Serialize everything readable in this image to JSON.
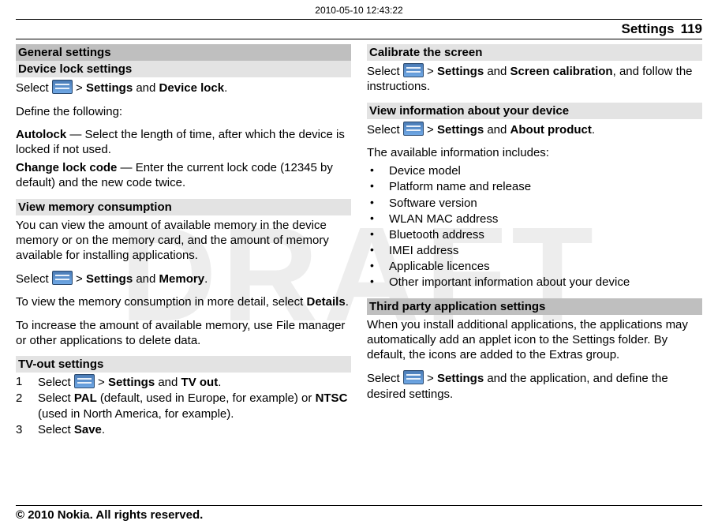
{
  "meta": {
    "timestamp": "2010-05-10 12:43:22",
    "watermark": "DRAFT"
  },
  "header": {
    "section": "Settings",
    "page_no": "119"
  },
  "footer": {
    "copyright": "© 2010 Nokia. All rights reserved."
  },
  "common": {
    "gt": ">",
    "and": "and",
    "settings_link": "Settings",
    "select": "Select"
  },
  "left": {
    "general_heading": "General settings",
    "device_lock": {
      "heading": "Device lock settings",
      "nav_target": "Device lock",
      "nav_suffix": ".",
      "define_intro": "Define the following:",
      "autolock_label": "Autolock",
      "autolock_desc": " — Select the length of time, after which the device is locked if not used.",
      "change_code_label": "Change lock code",
      "change_code_desc": " — Enter the current lock code (12345 by default) and the new code twice."
    },
    "memory": {
      "heading": "View memory consumption",
      "intro": "You can view the amount of available memory in the device memory or on the memory card, and the amount of memory available for installing applications.",
      "nav_target": "Memory",
      "nav_suffix": ".",
      "details_pre": "To view the memory consumption in more detail, select ",
      "details_link": "Details",
      "details_post": ".",
      "increase": "To increase the amount of available memory, use File manager or other applications to delete data."
    },
    "tvout": {
      "heading": "TV-out settings",
      "step1_target": "TV out",
      "step1_suffix": ".",
      "step2_pre": "Select ",
      "step2_pal": "PAL",
      "step2_mid": " (default, used in Europe, for example) or ",
      "step2_ntsc": "NTSC",
      "step2_post": " (used in North America, for example).",
      "step3_pre": "Select ",
      "step3_save": "Save",
      "step3_post": "."
    }
  },
  "right": {
    "calibrate": {
      "heading": "Calibrate the screen",
      "nav_target": "Screen calibration",
      "nav_suffix": ", and follow the instructions."
    },
    "about": {
      "heading": "View information about your device",
      "nav_target": "About product",
      "nav_suffix": ".",
      "list_intro": "The available information includes:",
      "items": [
        "Device model",
        "Platform name and release",
        "Software version",
        "WLAN MAC address",
        "Bluetooth address",
        "IMEI address",
        "Applicable licences",
        "Other important information about your device"
      ]
    },
    "third_party": {
      "heading": "Third party application settings",
      "intro": "When you install additional applications, the applications may automatically add an applet icon to the Settings folder. By default, the icons are added to the Extras group.",
      "nav_mid": " and the application, and define the desired settings."
    }
  }
}
